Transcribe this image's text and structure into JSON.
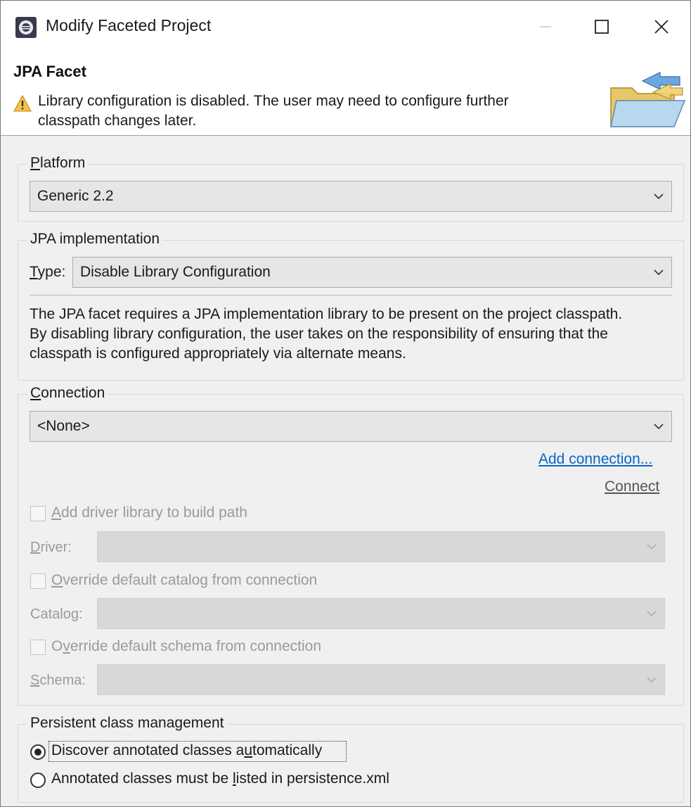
{
  "window": {
    "title": "Modify Faceted Project"
  },
  "header": {
    "title": "JPA Facet",
    "warning_line1": "Library configuration is disabled. The user may need to configure further",
    "warning_line2": "classpath changes later."
  },
  "platform": {
    "group_label_first": "P",
    "group_label_rest": "latform",
    "selected": "Generic 2.2"
  },
  "jpa_implementation": {
    "group_label": "JPA implementation",
    "type_label_first": "T",
    "type_label_rest": "ype:",
    "type_selected": "Disable Library Configuration",
    "description_line1": "The JPA facet requires a JPA implementation library to be present on the project classpath.",
    "description_line2": "By disabling library configuration, the user takes on the responsibility of ensuring that the",
    "description_line3": "classpath is configured appropriately via alternate means."
  },
  "connection": {
    "group_label_first": "C",
    "group_label_rest": "onnection",
    "selected": "<None>",
    "add_connection_link": "Add connection...",
    "connect_link": "Connect",
    "add_driver_first": "A",
    "add_driver_rest": "dd driver library to build path",
    "driver_label_first": "D",
    "driver_label_rest": "river:",
    "override_catalog_first": "O",
    "override_catalog_rest": "verride default catalog from connection",
    "catalog_label_pre": "Catalo",
    "catalog_label_u": "g",
    "catalog_label_post": ":",
    "override_schema_pre": "O",
    "override_schema_u": "v",
    "override_schema_post": "erride default schema from connection",
    "schema_label_first": "S",
    "schema_label_rest": "chema:"
  },
  "persistent": {
    "group_label": "Persistent class management",
    "option1_pre": "Discover annotated classes a",
    "option1_u": "u",
    "option1_post": "tomatically",
    "option2_pre": "Annotated classes must be ",
    "option2_u": "l",
    "option2_post": "isted in persistence.xml"
  },
  "colors": {
    "link": "#0b63c8",
    "disabled_text": "#9a9a9a",
    "warning_fill": "#f6c343"
  }
}
